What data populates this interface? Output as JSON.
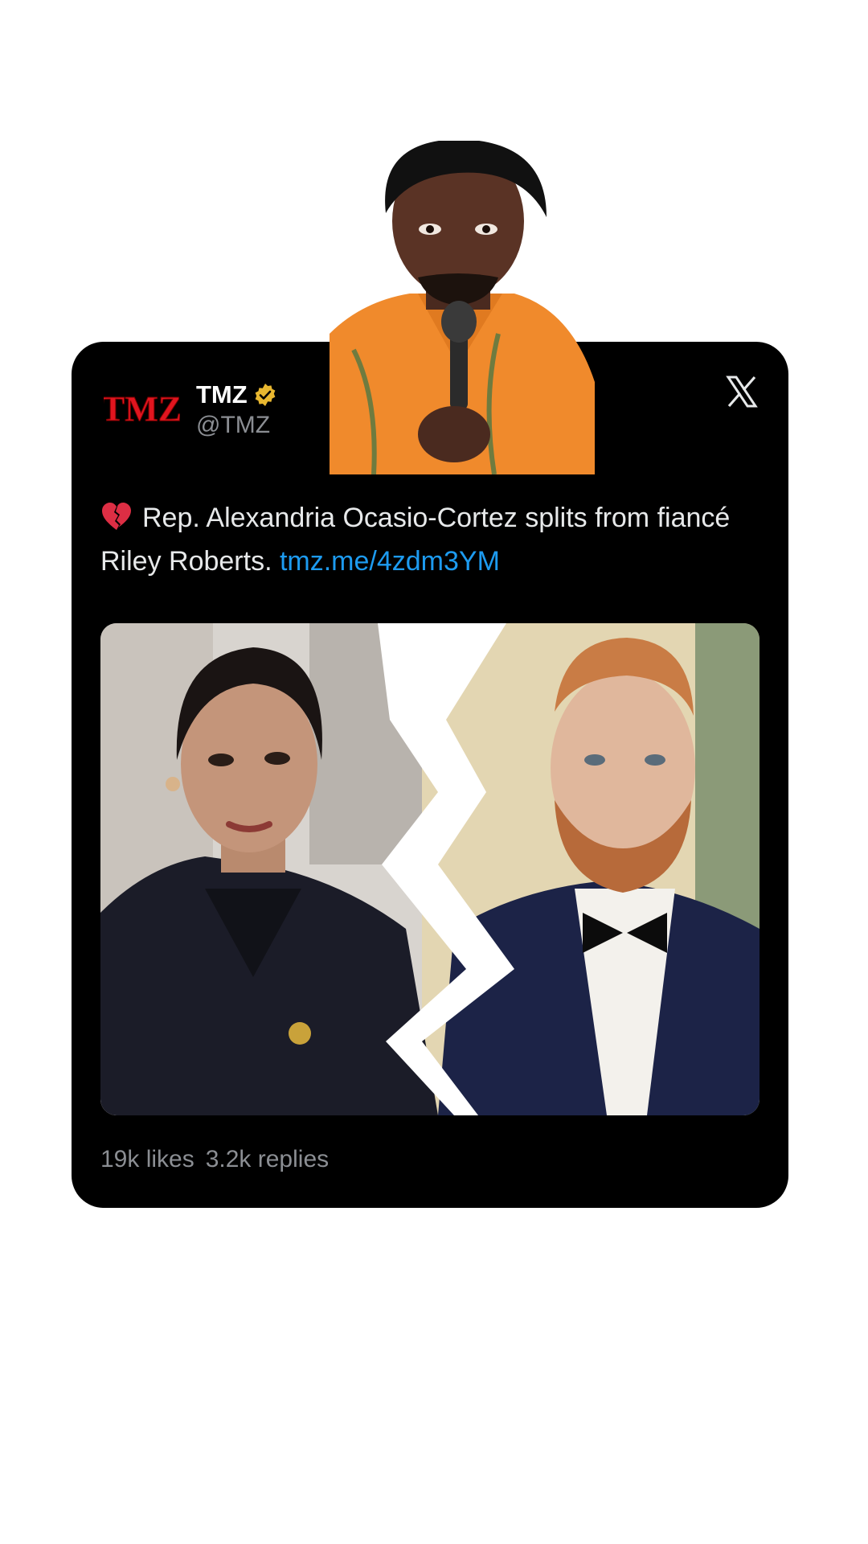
{
  "tweet": {
    "author_name": "TMZ",
    "handle": "@TMZ",
    "logo_text": "TMZ",
    "text": "Rep. Alexandria Ocasio-Cortez splits from fiancé Riley Roberts.",
    "link": "tmz.me/4zdm3YM",
    "likes": "19k likes",
    "replies": "3.2k replies"
  },
  "icons": {
    "close": "x-logo-icon",
    "verified": "verified-badge-icon",
    "emoji": "broken-heart-icon"
  },
  "colors": {
    "card_bg": "#000000",
    "link": "#1d9bf0",
    "muted": "#8b8e93",
    "logo_red": "#e0151f",
    "verified_gold": "#e8b730"
  }
}
